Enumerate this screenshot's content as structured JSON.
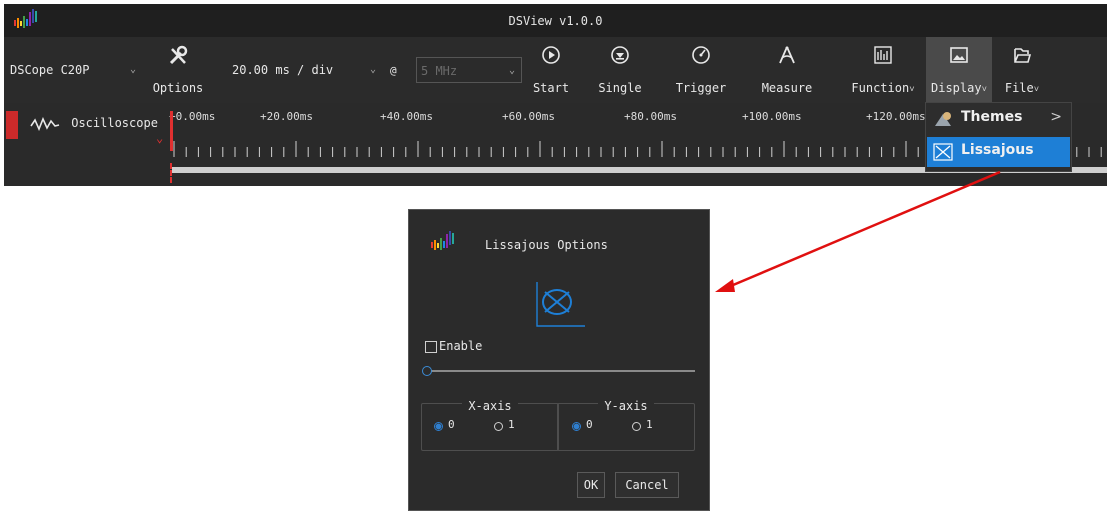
{
  "window": {
    "title": "DSView v1.0.0"
  },
  "toolbar": {
    "device": "DSCope C20P",
    "options_label": "Options",
    "timebase": "20.00 ms / div",
    "at_symbol": "@",
    "sample_rate": "5 MHz",
    "start_label": "Start",
    "single_label": "Single",
    "trigger_label": "Trigger",
    "measure_label": "Measure",
    "function_label": "Function",
    "display_label": "Display",
    "file_label": "File",
    "dropdown_caret": "˅"
  },
  "timeline": {
    "channel_label": "Oscilloscope",
    "ticks": [
      "+0.00ms",
      "+20.00ms",
      "+40.00ms",
      "+60.00ms",
      "+80.00ms",
      "+100.00ms",
      "+120.00ms"
    ]
  },
  "display_menu": {
    "items": [
      {
        "label": "Themes",
        "submenu_arrow": ">",
        "icon": "themes-icon"
      },
      {
        "label": "Lissajous",
        "icon": "lissajous-icon",
        "highlighted": true
      }
    ]
  },
  "dialog": {
    "title": "Lissajous Options",
    "enable_label": "Enable",
    "enable_checked": false,
    "slider_value": 0,
    "x_axis": {
      "title": "X-axis",
      "options": [
        "0",
        "1"
      ],
      "selected": "0"
    },
    "y_axis": {
      "title": "Y-axis",
      "options": [
        "0",
        "1"
      ],
      "selected": "0"
    },
    "ok_label": "OK",
    "cancel_label": "Cancel"
  },
  "colors": {
    "accent": "#1e7fd6",
    "marker_red": "#cc2a2a",
    "annotation_arrow": "#e01010",
    "background_dark": "#2b2b2b"
  }
}
